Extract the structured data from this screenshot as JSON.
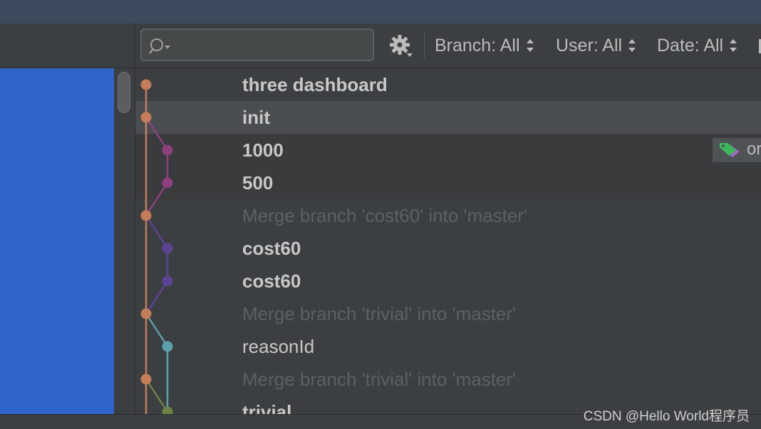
{
  "toolbar": {
    "search_placeholder": "",
    "filters": [
      {
        "label": "Branch: All"
      },
      {
        "label": "User: All"
      },
      {
        "label": "Date: All"
      }
    ]
  },
  "commits": [
    {
      "message": "three dashboard",
      "style": "bold",
      "node_color": "#c57c58"
    },
    {
      "message": "init",
      "style": "bold",
      "node_color": "#c57c58"
    },
    {
      "message": "1000",
      "style": "bold",
      "node_color": "#8e3f7e",
      "tag": "or"
    },
    {
      "message": "500",
      "style": "bold",
      "node_color": "#8e3f7e"
    },
    {
      "message": "Merge branch 'cost60' into 'master'",
      "style": "merge",
      "node_color": "#c57c58"
    },
    {
      "message": "cost60",
      "style": "bold",
      "node_color": "#5b4394"
    },
    {
      "message": "cost60",
      "style": "bold",
      "node_color": "#5b4394"
    },
    {
      "message": "Merge branch 'trivial' into 'master'",
      "style": "merge",
      "node_color": "#c57c58"
    },
    {
      "message": "reasonId",
      "style": "normal",
      "node_color": "#5da0ad"
    },
    {
      "message": "Merge branch 'trivial' into 'master'",
      "style": "merge",
      "node_color": "#c57c58"
    },
    {
      "message": "trivial",
      "style": "bold",
      "node_color": "#6c8247"
    }
  ],
  "colors": {
    "master": "#c57c58",
    "branch_purple": "#8e3f7e",
    "branch_violet": "#5b4394",
    "branch_teal": "#5da0ad",
    "branch_olive": "#6c8247",
    "selection": "#2f65ca",
    "tag_green": "#3bb85a"
  },
  "watermark": "CSDN @Hello World程序员"
}
